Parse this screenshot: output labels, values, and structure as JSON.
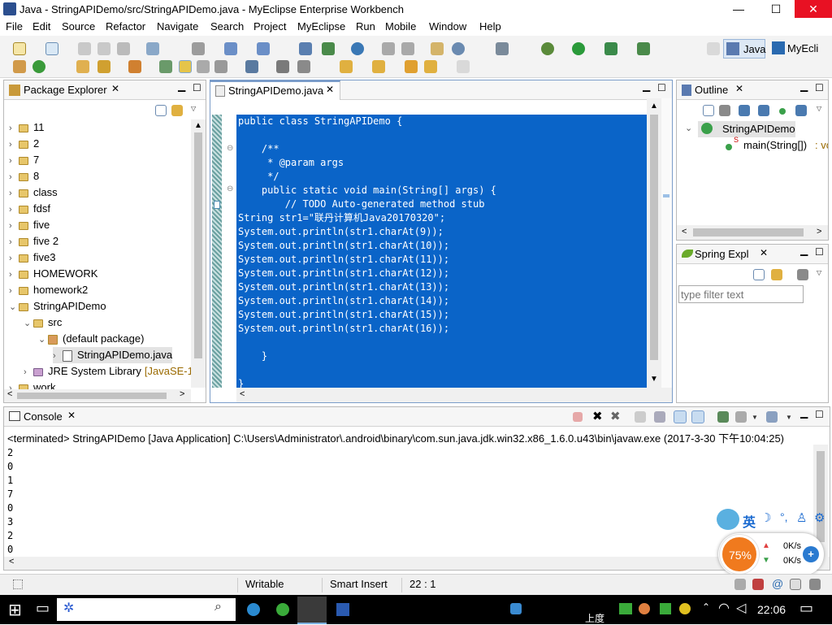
{
  "window": {
    "title": "Java - StringAPIDemo/src/StringAPIDemo.java - MyEclipse Enterprise Workbench",
    "min": "—",
    "max": "☐",
    "close": "✕"
  },
  "menu": [
    "File",
    "Edit",
    "Source",
    "Refactor",
    "Navigate",
    "Search",
    "Project",
    "MyEclipse",
    "Run",
    "Mobile",
    "Window",
    "Help"
  ],
  "perspectives": {
    "java": "Java",
    "myeclipse": "MyEcli"
  },
  "package_explorer": {
    "title": "Package Explorer",
    "items": [
      {
        "label": "11",
        "indent": 0,
        "type": "project"
      },
      {
        "label": "2",
        "indent": 0,
        "type": "project"
      },
      {
        "label": "7",
        "indent": 0,
        "type": "project"
      },
      {
        "label": "8",
        "indent": 0,
        "type": "project"
      },
      {
        "label": "class",
        "indent": 0,
        "type": "project"
      },
      {
        "label": "fdsf",
        "indent": 0,
        "type": "project"
      },
      {
        "label": "five",
        "indent": 0,
        "type": "project"
      },
      {
        "label": "five 2",
        "indent": 0,
        "type": "project"
      },
      {
        "label": "five3",
        "indent": 0,
        "type": "project"
      },
      {
        "label": "HOMEWORK",
        "indent": 0,
        "type": "project"
      },
      {
        "label": "homework2",
        "indent": 0,
        "type": "project"
      },
      {
        "label": "StringAPIDemo",
        "indent": 0,
        "type": "project",
        "expanded": true
      },
      {
        "label": "src",
        "indent": 1,
        "type": "src",
        "expanded": true
      },
      {
        "label": "(default package)",
        "indent": 2,
        "type": "package",
        "expanded": true
      },
      {
        "label": "StringAPIDemo.java",
        "indent": 3,
        "type": "file",
        "selected": true
      },
      {
        "label": "JRE System Library",
        "suffix": "[JavaSE-1",
        "indent": 1,
        "type": "lib"
      },
      {
        "label": "work",
        "indent": 0,
        "type": "project"
      }
    ]
  },
  "editor": {
    "tab": "StringAPIDemo.java",
    "lines": [
      "public class StringAPIDemo {",
      "",
      "    /**",
      "     * @param args",
      "     */",
      "    public static void main(String[] args) {",
      "        // TODO Auto-generated method stub",
      "String str1=\"联丹计算机Java20170320\";",
      "System.out.println(str1.charAt(9));",
      "System.out.println(str1.charAt(10));",
      "System.out.println(str1.charAt(11));",
      "System.out.println(str1.charAt(12));",
      "System.out.println(str1.charAt(13));",
      "System.out.println(str1.charAt(14));",
      "System.out.println(str1.charAt(15));",
      "System.out.println(str1.charAt(16));",
      "",
      "    }",
      "",
      "}"
    ]
  },
  "outline": {
    "title": "Outline",
    "class_name": "StringAPIDemo",
    "method": "main(String[])",
    "method_suffix": " : vo"
  },
  "spring": {
    "title": "Spring Expl",
    "filter_placeholder": "type filter text"
  },
  "console": {
    "title": "Console",
    "header": "<terminated> StringAPIDemo [Java Application] C:\\Users\\Administrator\\.android\\binary\\com.sun.java.jdk.win32.x86_1.6.0.u43\\bin\\javaw.exe (2017-3-30 下午10:04:25)",
    "output": [
      "2",
      "0",
      "1",
      "7",
      "0",
      "3",
      "2",
      "0"
    ]
  },
  "status": {
    "writable": "Writable",
    "insert": "Smart Insert",
    "position": "22 : 1"
  },
  "widget": {
    "percent": "75%",
    "up": "0K/s",
    "down": "0K/s",
    "ime": "英"
  },
  "taskbar": {
    "clock": "22:06",
    "baidu": "上度"
  },
  "colors": {
    "accent": "#0a64c8",
    "selection": "#0a64c8",
    "orange": "#f07a1e"
  }
}
